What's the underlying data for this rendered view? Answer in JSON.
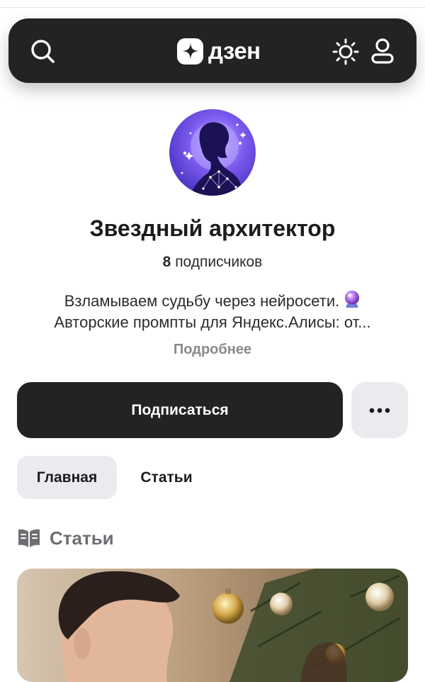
{
  "header": {
    "logo_text": "дзен",
    "icons": [
      "search-icon",
      "dzen-logo-icon",
      "theme-sun-icon",
      "profile-icon"
    ]
  },
  "channel": {
    "name": "Звездный архитектор",
    "subscribers_count": "8",
    "subscribers_label": "подписчиков",
    "description_line1": "Взламываем судьбу через нейросети.",
    "description_line2": "Авторские промпты для Яндекс.Алисы: от...",
    "more_link": "Подробнее"
  },
  "actions": {
    "subscribe_label": "Подписаться",
    "more_icon": "more-dots-icon"
  },
  "tabs": [
    {
      "label": "Главная",
      "active": true
    },
    {
      "label": "Статьи",
      "active": false
    }
  ],
  "section": {
    "title": "Статьи",
    "icon": "book-open-icon"
  },
  "colors": {
    "header_bg": "#232225",
    "button_dark": "#232225",
    "button_light": "#ebebef",
    "muted_text": "#8a8a8e",
    "avatar_purple": "#6b4ee0"
  }
}
